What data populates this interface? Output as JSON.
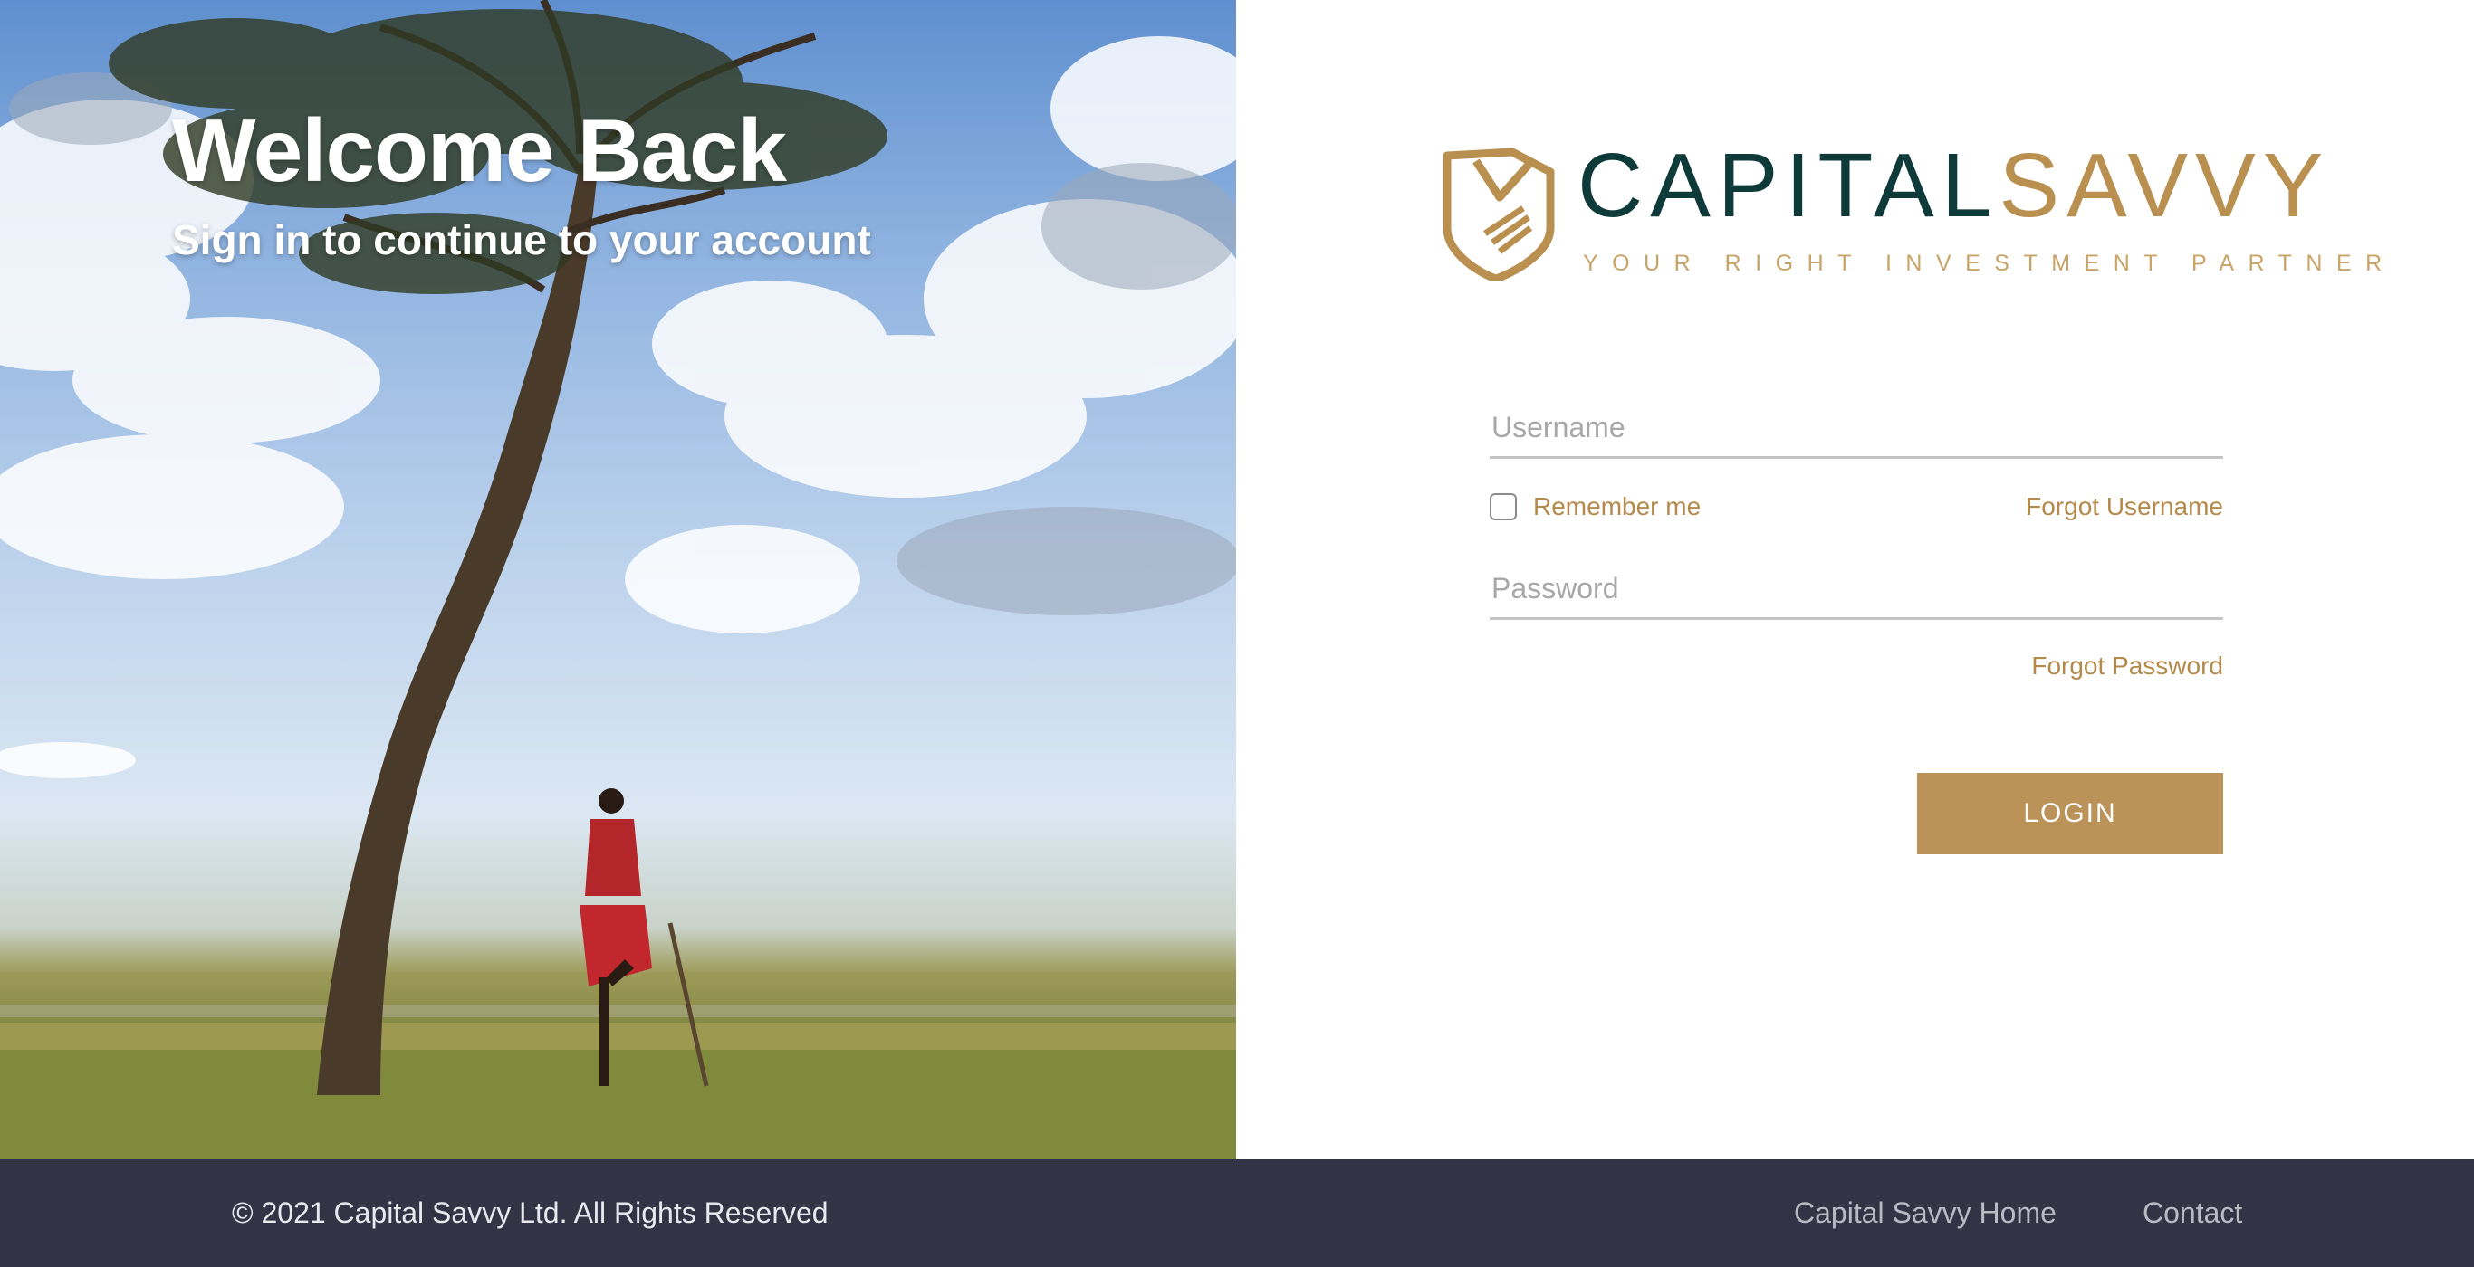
{
  "hero": {
    "title": "Welcome Back",
    "subtitle": "Sign in to continue to your account"
  },
  "brand": {
    "name_part1": "CAPITAL",
    "name_part2": "SAVVY",
    "tagline": "YOUR RIGHT INVESTMENT PARTNER",
    "colors": {
      "dark_teal": "#0e3b3a",
      "gold": "#b99050"
    }
  },
  "form": {
    "username_placeholder": "Username",
    "remember_label": "Remember me",
    "forgot_username": "Forgot Username",
    "password_placeholder": "Password",
    "forgot_password": "Forgot Password",
    "login_label": "LOGIN"
  },
  "footer": {
    "copyright": "© 2021 Capital Savvy Ltd. All Rights Reserved",
    "home_link": "Capital Savvy Home",
    "contact_link": "Contact"
  },
  "colors": {
    "accent": "#bb9358",
    "footer_bg": "#323446"
  }
}
